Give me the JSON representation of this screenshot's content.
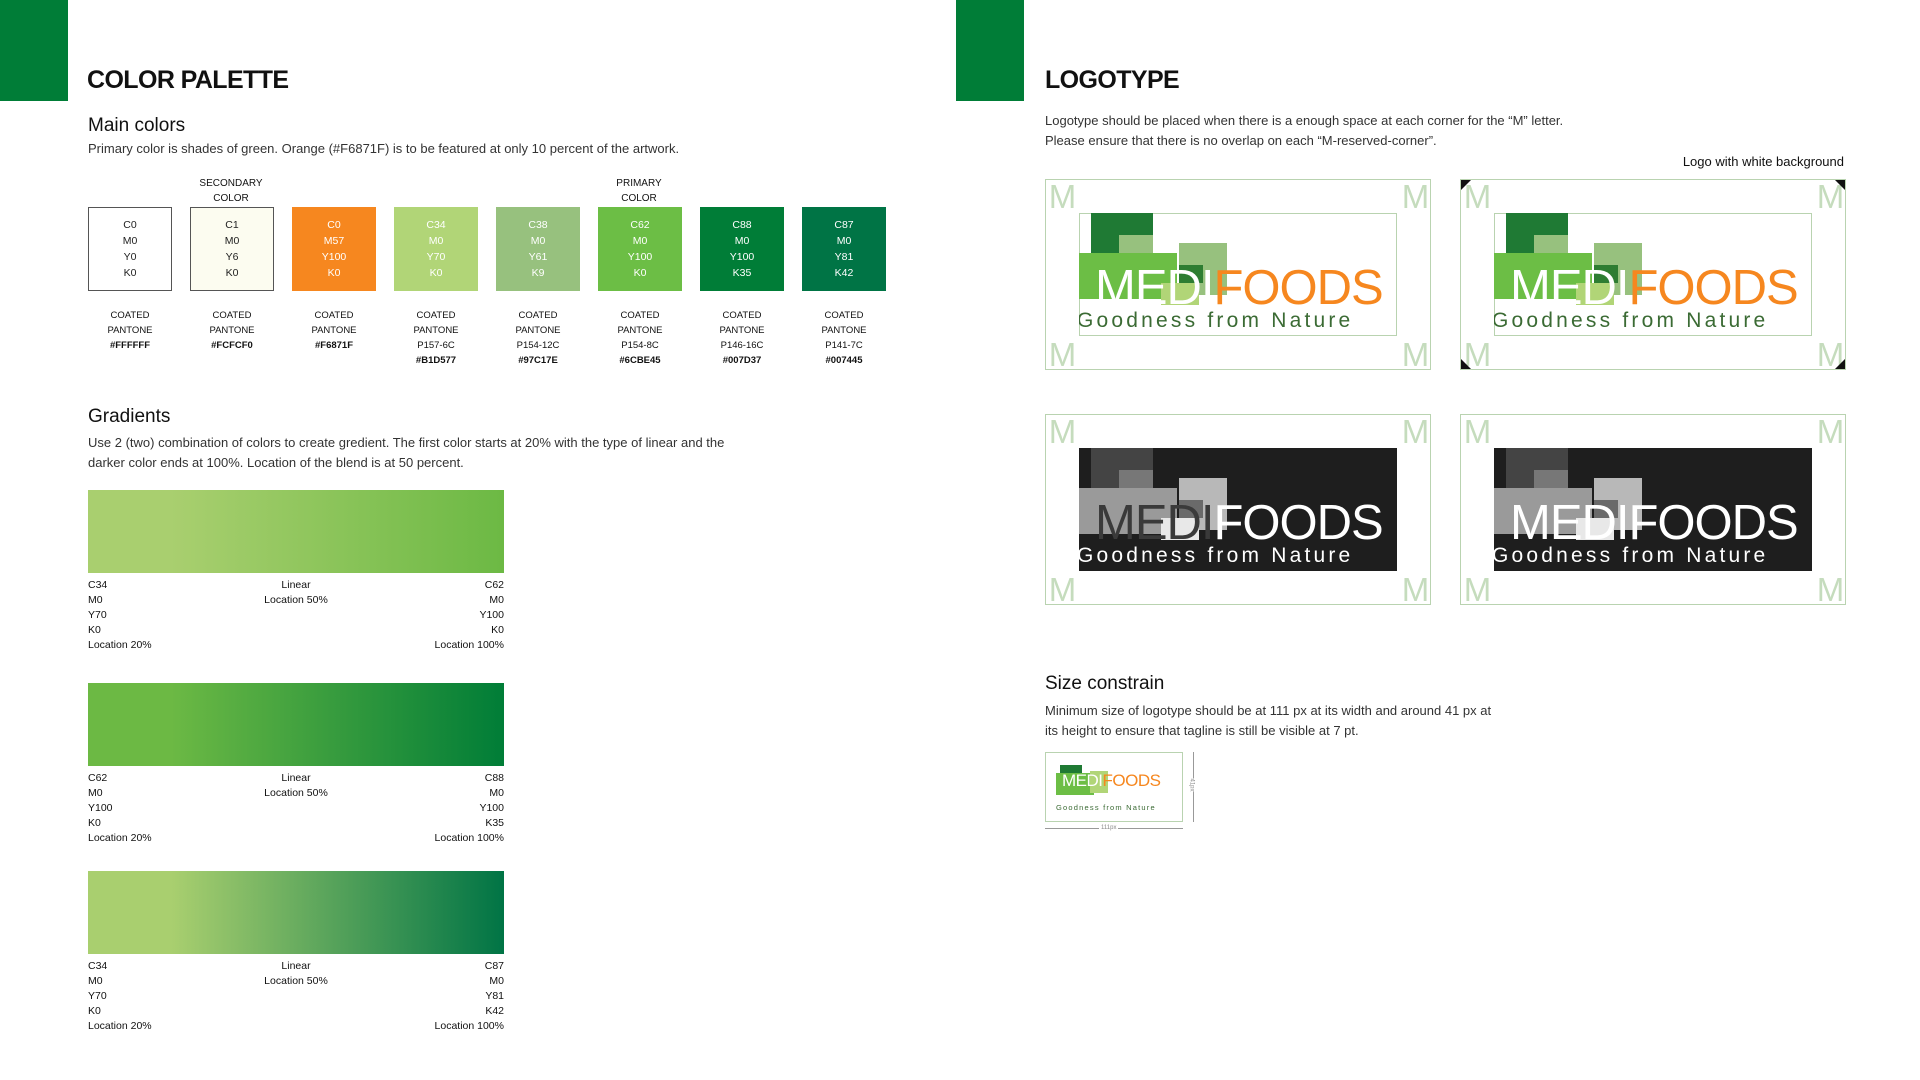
{
  "left": {
    "title": "COLOR PALETTE",
    "main_colors": {
      "heading": "Main colors",
      "description": "Primary color is shades of green. Orange (#F6871F) is to be featured at only 10 percent of the artwork.",
      "group_labels": {
        "secondary": [
          "SECONDARY",
          "COLOR"
        ],
        "primary": [
          "PRIMARY",
          "COLOR"
        ]
      },
      "swatches": [
        {
          "color": "#FFFFFF",
          "text_color": "#222222",
          "cmyk": [
            "C0",
            "M0",
            "Y0",
            "K0"
          ],
          "caption": [
            "COATED",
            "PANTONE",
            "#FFFFFF"
          ]
        },
        {
          "color": "#FCFCF0",
          "text_color": "#222222",
          "cmyk": [
            "C1",
            "M0",
            "Y6",
            "K0"
          ],
          "caption": [
            "COATED",
            "PANTONE",
            "#FCFCF0"
          ]
        },
        {
          "color": "#F6871F",
          "text_color": "#FFFFFF",
          "cmyk": [
            "C0",
            "M57",
            "Y100",
            "K0"
          ],
          "caption": [
            "COATED",
            "PANTONE",
            "#F6871F"
          ]
        },
        {
          "color": "#B1D577",
          "text_color": "#FFFFFF",
          "cmyk": [
            "C34",
            "M0",
            "Y70",
            "K0"
          ],
          "caption": [
            "COATED",
            "PANTONE",
            "P157-6C",
            "#B1D577"
          ]
        },
        {
          "color": "#97C17E",
          "text_color": "#FFFFFF",
          "cmyk": [
            "C38",
            "M0",
            "Y61",
            "K9"
          ],
          "caption": [
            "COATED",
            "PANTONE",
            "P154-12C",
            "#97C17E"
          ]
        },
        {
          "color": "#6CBE45",
          "text_color": "#FFFFFF",
          "cmyk": [
            "C62",
            "M0",
            "Y100",
            "K0"
          ],
          "caption": [
            "COATED",
            "PANTONE",
            "P154-8C",
            "#6CBE45"
          ]
        },
        {
          "color": "#007D37",
          "text_color": "#FFFFFF",
          "cmyk": [
            "C88",
            "M0",
            "Y100",
            "K35"
          ],
          "caption": [
            "COATED",
            "PANTONE",
            "P146-16C",
            "#007D37"
          ]
        },
        {
          "color": "#007445",
          "text_color": "#FFFFFF",
          "cmyk": [
            "C87",
            "M0",
            "Y81",
            "K42"
          ],
          "caption": [
            "COATED",
            "PANTONE",
            "P141-7C",
            "#007445"
          ]
        }
      ]
    },
    "gradients": {
      "heading": "Gradients",
      "description": [
        "Use 2 (two) combination of colors to create gredient. The first color starts at 20% with the type of linear and the",
        "darker color ends at 100%. Location of the blend is at 50 percent."
      ],
      "items": [
        {
          "from": "#A9CF6F",
          "to": "#6CB944",
          "left": [
            "C34",
            "M0",
            "Y70",
            "K0",
            "Location 20%"
          ],
          "center": [
            "Linear",
            "Location 50%"
          ],
          "right": [
            "C62",
            "M0",
            "Y100",
            "K0",
            "Location 100%"
          ]
        },
        {
          "from": "#6CB944",
          "to": "#007D37",
          "left": [
            "C62",
            "M0",
            "Y100",
            "K0",
            "Location 20%"
          ],
          "center": [
            "Linear",
            "Location 50%"
          ],
          "right": [
            "C88",
            "M0",
            "Y100",
            "K35",
            "Location 100%"
          ]
        },
        {
          "from": "#A9CF6F",
          "to": "#007445",
          "left": [
            "C34",
            "M0",
            "Y70",
            "K0",
            "Location 20%"
          ],
          "center": [
            "Linear",
            "Location 50%"
          ],
          "right": [
            "C87",
            "M0",
            "Y81",
            "K42",
            "Location 100%"
          ]
        }
      ]
    }
  },
  "right": {
    "title": "LOGOTYPE",
    "description": [
      "Logotype should be placed when there is a enough space at each corner for the “M” letter.",
      "Please ensure that there is no overlap on each “M-reserved-corner”."
    ],
    "white_bg_label": "Logo with white background",
    "corner_mark": "M",
    "logo": {
      "word_a": "MEDI",
      "word_b": "FOODS",
      "tagline": "Goodness from Nature"
    },
    "size_constrain": {
      "heading": "Size constrain",
      "description": [
        "Minimum size of logotype should be at 111 px at its width and around 41 px at",
        "its height to ensure that tagline is still be visible at 7 pt."
      ],
      "width_label": "111px",
      "height_label": "41px"
    }
  },
  "colors": {
    "accent_green": "#007D37",
    "orange": "#F6871F",
    "guide": "#B9D3B0"
  }
}
